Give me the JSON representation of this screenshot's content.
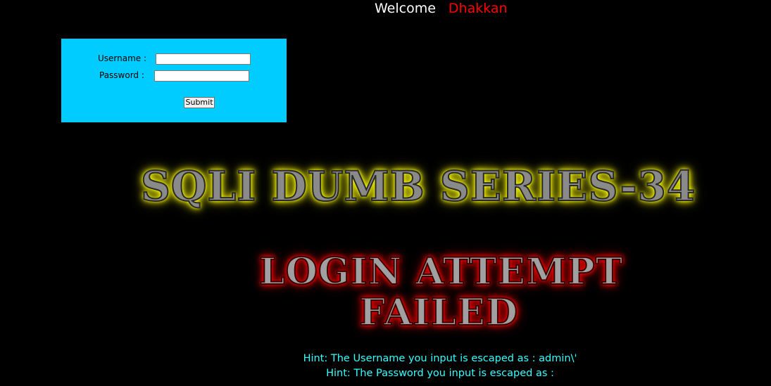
{
  "header": {
    "welcome_word": "Welcome",
    "welcome_name": "Dhakkan"
  },
  "login_form": {
    "username_label": "Username :",
    "password_label": "Password :",
    "username_value": "",
    "password_value": "",
    "submit_label": "Submit"
  },
  "main": {
    "series_title": "SQLI DUMB SERIES-34",
    "fail_line1": "LOGIN ATTEMPT",
    "fail_line2": "FAILED"
  },
  "hints": {
    "username_hint": "Hint: The Username you input is escaped as : admin\\'",
    "password_hint": "Hint: The Password you input is escaped as :"
  },
  "colors": {
    "background": "#000000",
    "form_background": "#00ccff",
    "welcome_text": "#ffffff",
    "name_text": "#ff0000",
    "series_glow": "#ffff00",
    "fail_glow": "#ff0000",
    "hint_text": "#33ffff"
  }
}
